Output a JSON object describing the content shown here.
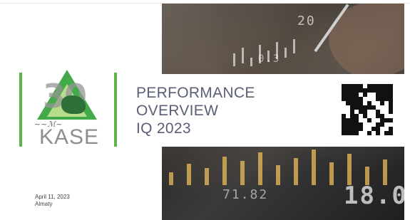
{
  "slide": {
    "title_lines": [
      "PERFORMANCE",
      "OVERVIEW",
      "IQ 2023"
    ],
    "brand": "KASE",
    "anniversary_number": "30",
    "date": "April 11, 2023",
    "location": "Almaty"
  },
  "photo": {
    "digits_top": "20",
    "digits_mid": "0.3",
    "digits_bottom": "71.82",
    "digits_bottom_right": "18.0"
  },
  "colors": {
    "accent_green": "#5cb546",
    "title_text": "#5b5f75",
    "brand_gray": "#8e8e8e"
  },
  "icons": [
    "qr-code-icon",
    "bull-icon"
  ]
}
